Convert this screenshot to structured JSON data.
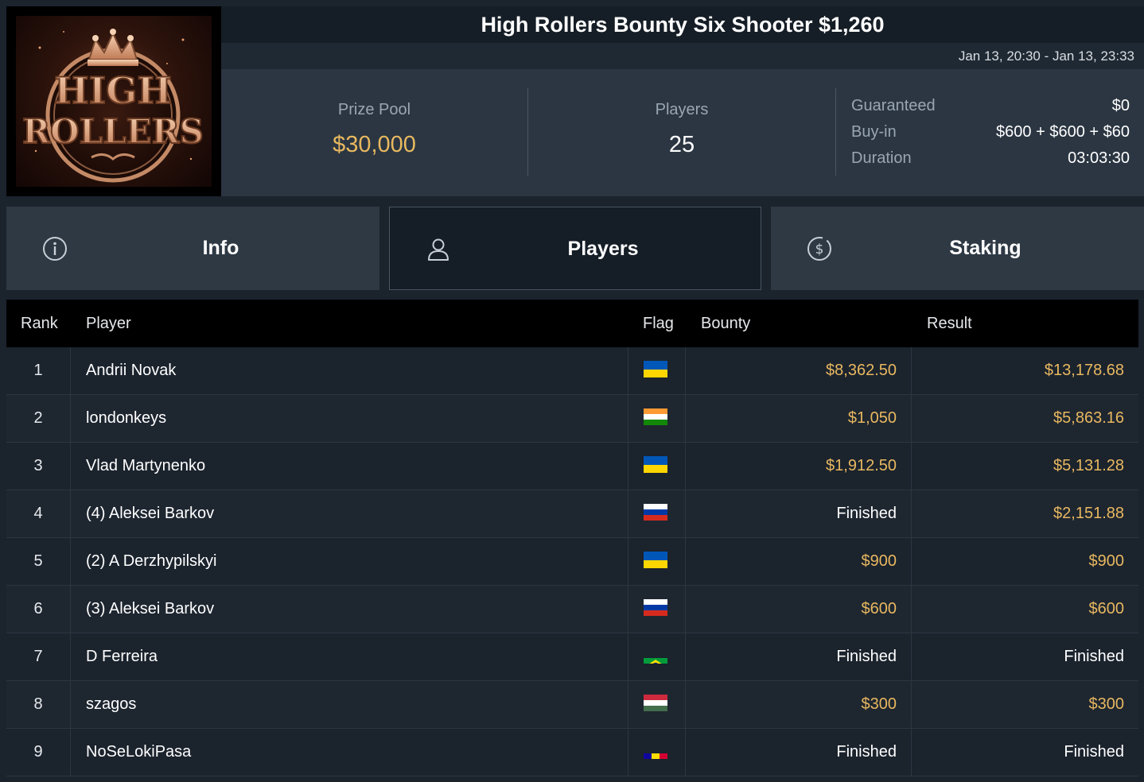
{
  "header": {
    "title": "High Rollers Bounty Six Shooter $1,260",
    "date_range": "Jan 13, 20:30 - Jan 13, 23:33",
    "logo_text_top": "HIGH",
    "logo_text_bottom": "ROLLERS"
  },
  "stats": {
    "prize_pool_label": "Prize Pool",
    "prize_pool_value": "$30,000",
    "players_label": "Players",
    "players_value": "25",
    "details": [
      {
        "label": "Guaranteed",
        "value": "$0"
      },
      {
        "label": "Buy-in",
        "value": "$600 + $600 + $60"
      },
      {
        "label": "Duration",
        "value": "03:03:30"
      }
    ]
  },
  "tabs": [
    {
      "label": "Info",
      "icon": "info-icon",
      "active": false
    },
    {
      "label": "Players",
      "icon": "user-icon",
      "active": true
    },
    {
      "label": "Staking",
      "icon": "dollar-icon",
      "active": false
    }
  ],
  "table": {
    "headers": {
      "rank": "Rank",
      "player": "Player",
      "flag": "Flag",
      "bounty": "Bounty",
      "result": "Result"
    },
    "rows": [
      {
        "rank": "1",
        "player": "Andrii Novak",
        "flag": "ukraine-flag",
        "bounty": "$8,362.50",
        "result": "$13,178.68"
      },
      {
        "rank": "2",
        "player": "londonkeys",
        "flag": "india-flag",
        "bounty": "$1,050",
        "result": "$5,863.16"
      },
      {
        "rank": "3",
        "player": "Vlad Martynenko",
        "flag": "ukraine-flag",
        "bounty": "$1,912.50",
        "result": "$5,131.28"
      },
      {
        "rank": "4",
        "player": "(4) Aleksei Barkov",
        "flag": "russia-flag",
        "bounty": "Finished",
        "result": "$2,151.88"
      },
      {
        "rank": "5",
        "player": "(2) A Derzhypilskyi",
        "flag": "ukraine-flag",
        "bounty": "$900",
        "result": "$900"
      },
      {
        "rank": "6",
        "player": "(3) Aleksei Barkov",
        "flag": "russia-flag",
        "bounty": "$600",
        "result": "$600"
      },
      {
        "rank": "7",
        "player": "D Ferreira",
        "flag": "brazil-flag",
        "bounty": "Finished",
        "result": "Finished"
      },
      {
        "rank": "8",
        "player": "szagos",
        "flag": "hungary-flag",
        "bounty": "$300",
        "result": "$300"
      },
      {
        "rank": "9",
        "player": "NoSeLokiPasa",
        "flag": "andorra-flag",
        "bounty": "Finished",
        "result": "Finished"
      }
    ]
  },
  "colors": {
    "accent_gold": "#e8b860",
    "background": "#1b232d",
    "panel": "#2b3642",
    "active_tab": "#151d26"
  }
}
